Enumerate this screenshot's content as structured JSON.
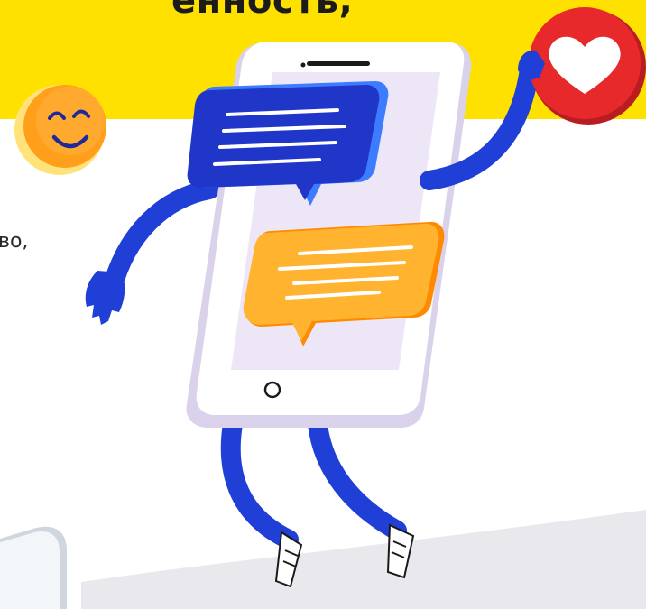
{
  "headline": {
    "text": "енность,"
  },
  "body": {
    "fragment": "во,"
  },
  "colors": {
    "band": "#ffe100",
    "phone": "#ece6f6",
    "blue_bubble": "#1f36c9",
    "orange_bubble": "#ff9b1f",
    "heart_badge": "#e8292b",
    "smiley": "#ff9f1c",
    "limbs": "#1f3fd6"
  },
  "icons": {
    "smiley": "smiley-emoji-icon",
    "heart": "heart-badge-icon",
    "chat_blue": "chat-bubble-icon",
    "chat_orange": "chat-bubble-icon"
  }
}
